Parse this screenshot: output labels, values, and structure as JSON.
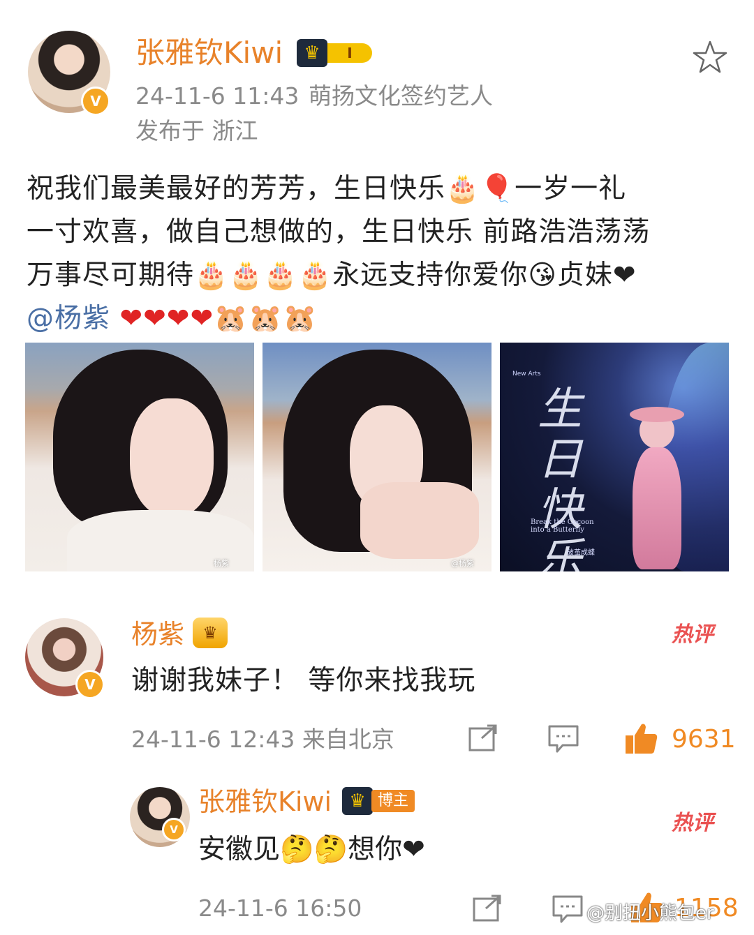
{
  "post": {
    "author": "张雅钦Kiwi",
    "level_badge": "I",
    "timestamp": "24-11-6 11:43",
    "affiliation": "萌扬文化签约艺人",
    "location": "发布于 浙江",
    "lines": [
      "祝我们最美最好的芳芳，生日快乐🎂🎈一岁一礼",
      "一寸欢喜，做自己想做的，生日快乐 前路浩浩荡荡",
      "万事尽可期待🎂🎂🎂🎂永远支持你爱你😘贞妹❤"
    ],
    "mention": "@杨紫",
    "mention_emoji": "❤❤❤❤🐹🐹🐹",
    "photos": [
      {
        "alt": "portrait-1",
        "watermark": "杨紫"
      },
      {
        "alt": "portrait-2",
        "watermark": "@杨紫"
      },
      {
        "alt": "poster",
        "title": "生日快乐",
        "subtitle": "Break the Cocoon into a Butterfly",
        "cn_subtitle": "破茧成蝶",
        "corner": "New Arts"
      }
    ]
  },
  "comments": [
    {
      "author": "杨紫",
      "text": "谢谢我妹子！ 等你来找我玩",
      "hot_label": "热评",
      "time_loc": "24-11-6 12:43 来自北京",
      "likes": "9631"
    },
    {
      "author": "张雅钦Kiwi",
      "tag": "博主",
      "text": "安徽见🤔🤔想你❤",
      "hot_label": "热评",
      "time_loc": "24-11-6 16:50",
      "likes": "1158"
    }
  ],
  "watermark": "@别扭小熊包er",
  "colors": {
    "username": "#e8822a",
    "meta": "#8a8a8a",
    "mention": "#4a6fa5",
    "hot": "#ea5252",
    "like": "#f08a24"
  },
  "icons": [
    "star-icon",
    "verified-icon",
    "share-icon",
    "comment-icon",
    "like-icon"
  ]
}
